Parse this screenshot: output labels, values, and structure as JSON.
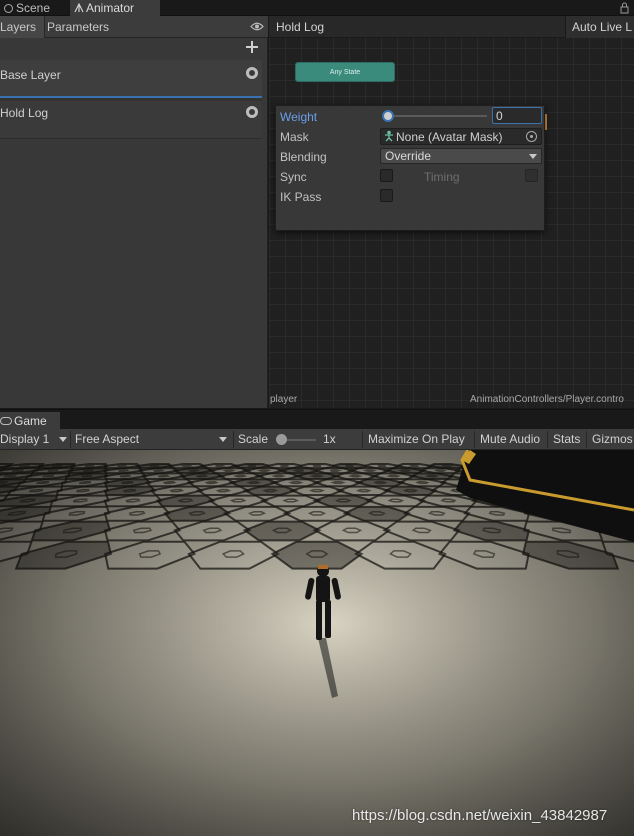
{
  "top_tabs": [
    {
      "label": "Scene",
      "icon": "scene-icon"
    },
    {
      "label": "Animator",
      "icon": "animator-icon"
    }
  ],
  "animator": {
    "layer_tabs": [
      "Layers",
      "Parameters"
    ],
    "layers": [
      {
        "name": "Base Layer",
        "selected": true
      },
      {
        "name": "Hold Log",
        "selected": false
      }
    ],
    "breadcrumb": "Hold Log",
    "auto_live_link": "Auto Live L",
    "any_state": "Any State",
    "settings_popup": {
      "weight_label": "Weight",
      "weight_value": "0",
      "weight_fraction": 0.0,
      "mask_label": "Mask",
      "mask_value": "None (Avatar Mask)",
      "blending_label": "Blending",
      "blending_value": "Override",
      "sync_label": "Sync",
      "timing_label": "Timing",
      "ikpass_label": "IK Pass"
    },
    "footer_left": "player",
    "footer_right": "AnimationControllers/Player.contro"
  },
  "game": {
    "tab_label": "Game",
    "display": "Display 1",
    "aspect": "Free Aspect",
    "scale_label": "Scale",
    "scale_value": "1x",
    "maximize": "Maximize On Play",
    "mute": "Mute Audio",
    "stats": "Stats",
    "gizmos": "Gizmos",
    "watermark": "https://blog.csdn.net/weixin_43842987"
  },
  "colors": {
    "accent_blue": "#3a72b0",
    "state_teal": "#3b8b7d",
    "panel": "#383838",
    "graph_bg": "#202020"
  }
}
